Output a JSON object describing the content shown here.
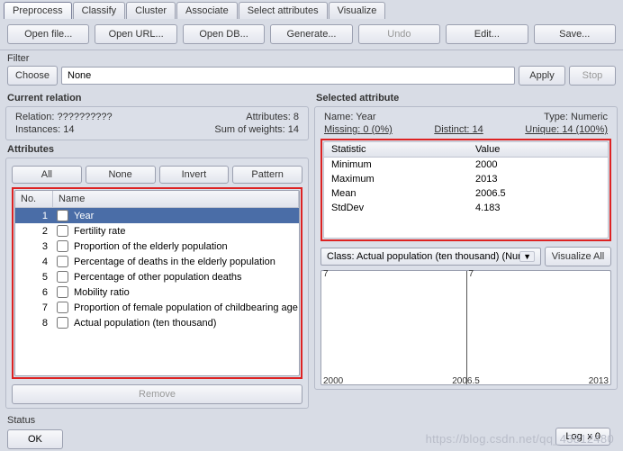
{
  "tabs": [
    "Preprocess",
    "Classify",
    "Cluster",
    "Associate",
    "Select attributes",
    "Visualize"
  ],
  "toolbar": {
    "open_file": "Open file...",
    "open_url": "Open URL...",
    "open_db": "Open DB...",
    "generate": "Generate...",
    "undo": "Undo",
    "edit": "Edit...",
    "save": "Save..."
  },
  "filter": {
    "heading": "Filter",
    "choose": "Choose",
    "value": "None",
    "apply": "Apply",
    "stop": "Stop"
  },
  "current_relation": {
    "heading": "Current relation",
    "relation_label": "Relation:",
    "relation_value": "??????????",
    "attributes_label": "Attributes:",
    "attributes_value": "8",
    "instances_label": "Instances:",
    "instances_value": "14",
    "weights_label": "Sum of weights:",
    "weights_value": "14"
  },
  "attributes_panel": {
    "heading": "Attributes",
    "buttons": {
      "all": "All",
      "none": "None",
      "invert": "Invert",
      "pattern": "Pattern"
    },
    "cols": {
      "no": "No.",
      "name": "Name"
    },
    "rows": [
      {
        "no": "1",
        "name": "Year",
        "selected": true
      },
      {
        "no": "2",
        "name": "Fertility rate"
      },
      {
        "no": "3",
        "name": "Proportion of the elderly population"
      },
      {
        "no": "4",
        "name": "Percentage of deaths in the elderly population"
      },
      {
        "no": "5",
        "name": "Percentage of other population deaths"
      },
      {
        "no": "6",
        "name": "Mobility ratio"
      },
      {
        "no": "7",
        "name": "Proportion of female population of childbearing age"
      },
      {
        "no": "8",
        "name": "Actual population (ten thousand)"
      }
    ],
    "remove": "Remove"
  },
  "selected_attribute": {
    "heading": "Selected attribute",
    "name_label": "Name:",
    "name_value": "Year",
    "type_label": "Type:",
    "type_value": "Numeric",
    "missing_label": "Missing:",
    "missing_value": "0 (0%)",
    "distinct_label": "Distinct:",
    "distinct_value": "14",
    "unique_label": "Unique:",
    "unique_value": "14 (100%)",
    "stat_head": {
      "stat": "Statistic",
      "val": "Value"
    },
    "stats": [
      {
        "name": "Minimum",
        "value": "2000"
      },
      {
        "name": "Maximum",
        "value": "2013"
      },
      {
        "name": "Mean",
        "value": "2006.5"
      },
      {
        "name": "StdDev",
        "value": "4.183"
      }
    ]
  },
  "class_row": {
    "select": "Class: Actual population (ten thousand) (Num)",
    "viz_all": "Visualize All"
  },
  "chart_data": {
    "type": "bar",
    "x": [
      2000,
      2006.5,
      2013
    ],
    "top_labels": [
      "7",
      "7"
    ],
    "values": [],
    "note": "histogram preview with two bins labelled 7"
  },
  "status": {
    "heading": "Status",
    "ok": "OK",
    "log": "Log",
    "x0": "x 0"
  },
  "watermark": "https://blog.csdn.net/qq_43812480"
}
